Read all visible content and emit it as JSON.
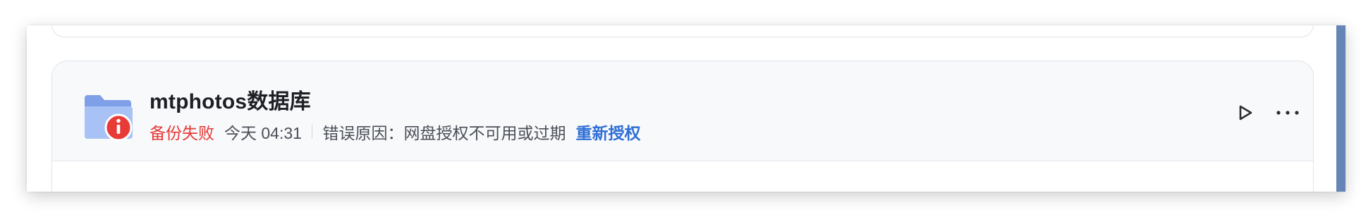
{
  "task": {
    "title": "mtphotos数据库",
    "status": "备份失败",
    "time": "今天 04:31",
    "error_prefix": "错误原因：",
    "error_message": "网盘授权不可用或过期",
    "reauthorize_label": "重新授权"
  },
  "icons": {
    "folder": "folder-icon",
    "error_badge": "error-badge-icon",
    "play": "play-icon",
    "more": "more-icon"
  },
  "colors": {
    "status_error": "#e53935",
    "link": "#2f6ed6",
    "folder": "#8faef0",
    "scrollbar": "#6585b7"
  }
}
